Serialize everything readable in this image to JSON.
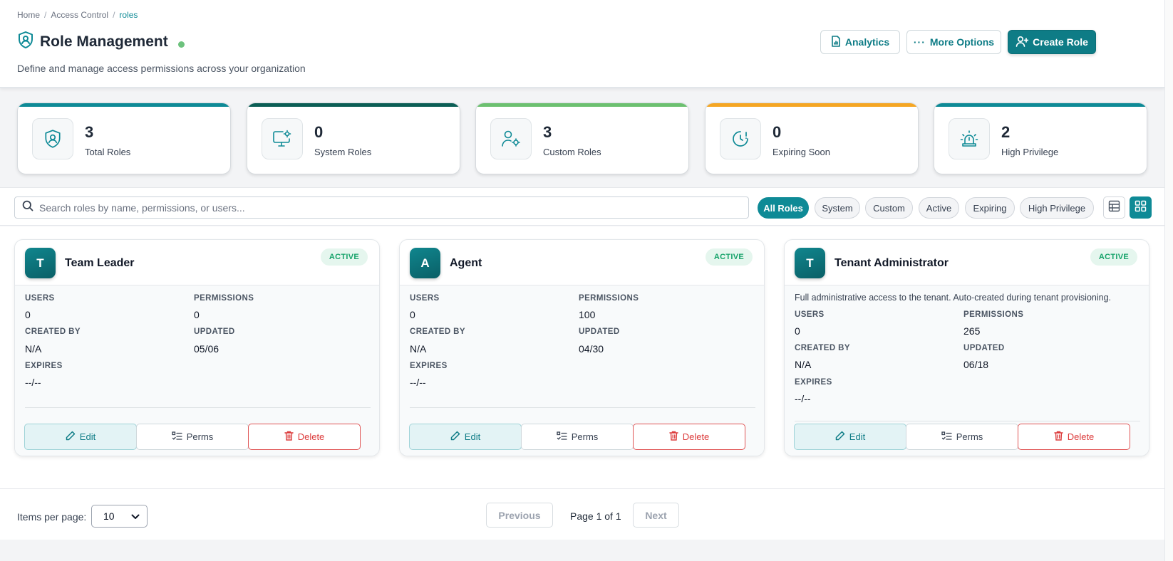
{
  "breadcrumb": [
    "Home",
    "Access Control",
    "roles"
  ],
  "header": {
    "title": "Role Management",
    "subtitle": "Define and manage access permissions across your organization",
    "analytics_label": "Analytics",
    "more_label": "More Options",
    "create_label": "Create Role"
  },
  "stats": [
    {
      "value": "3",
      "label": "Total Roles",
      "accent": "#0e8a96",
      "icon": "shield-user-icon"
    },
    {
      "value": "0",
      "label": "System Roles",
      "accent": "#0b5e55",
      "icon": "monitor-gear-icon"
    },
    {
      "value": "3",
      "label": "Custom Roles",
      "accent": "#6cc070",
      "icon": "user-gear-icon"
    },
    {
      "value": "0",
      "label": "Expiring Soon",
      "accent": "#f5a623",
      "icon": "clock-alert-icon"
    },
    {
      "value": "2",
      "label": "High Privilege",
      "accent": "#0e8a96",
      "icon": "siren-icon"
    }
  ],
  "search": {
    "placeholder": "Search roles by name, permissions, or users..."
  },
  "filters": [
    "All Roles",
    "System",
    "Custom",
    "Active",
    "Expiring",
    "High Privilege"
  ],
  "active_filter": "All Roles",
  "field_labels": {
    "users": "USERS",
    "permissions": "PERMISSIONS",
    "created_by": "CREATED BY",
    "updated": "UPDATED",
    "expires": "EXPIRES"
  },
  "card_actions": {
    "edit": "Edit",
    "perms": "Perms",
    "delete": "Delete"
  },
  "roles": [
    {
      "initial": "T",
      "name": "Team Leader",
      "status": "ACTIVE",
      "description": "",
      "users": "0",
      "permissions": "0",
      "created_by": "N/A",
      "updated": "05/06",
      "expires": "--/--"
    },
    {
      "initial": "A",
      "name": "Agent",
      "status": "ACTIVE",
      "description": "",
      "users": "0",
      "permissions": "100",
      "created_by": "N/A",
      "updated": "04/30",
      "expires": "--/--"
    },
    {
      "initial": "T",
      "name": "Tenant Administrator",
      "status": "ACTIVE",
      "description": "Full administrative access to the tenant. Auto-created during tenant provisioning.",
      "users": "0",
      "permissions": "265",
      "created_by": "N/A",
      "updated": "06/18",
      "expires": "--/--"
    }
  ],
  "pagination": {
    "items_label": "Items per page:",
    "per_page": "10",
    "previous": "Previous",
    "info": "Page 1 of 1",
    "next": "Next"
  },
  "colors": {
    "primary": "#0e7c86",
    "active_badge": "#16a36a",
    "danger": "#dc3b3b"
  }
}
